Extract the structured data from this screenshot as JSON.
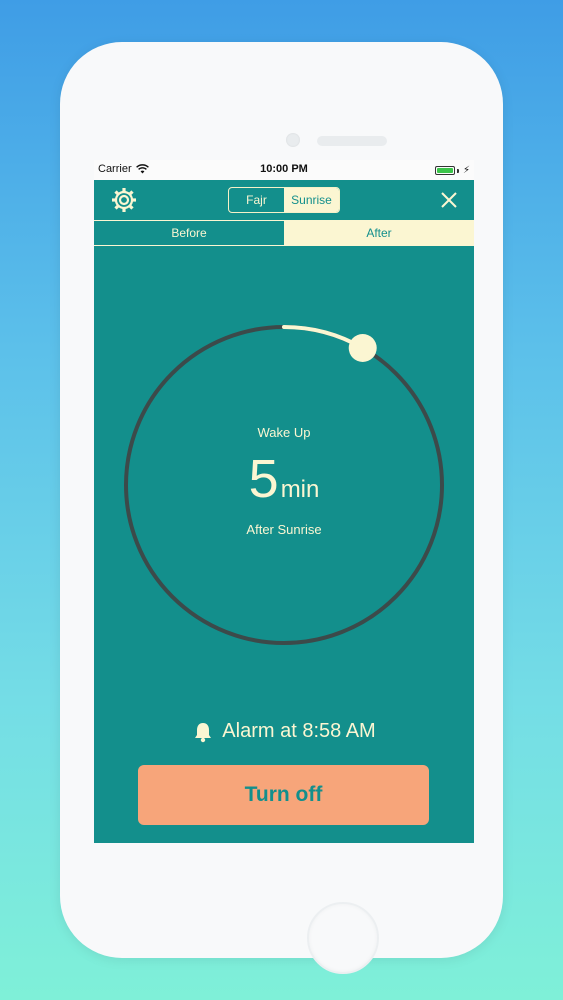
{
  "status_bar": {
    "carrier": "Carrier",
    "time": "10:00 PM",
    "battery_level_percent": 100,
    "wifi_icon": "wifi-icon",
    "charging_icon": "bolt-icon"
  },
  "nav": {
    "settings_icon": "gear-icon",
    "close_icon": "close-icon",
    "segments": [
      "Fajr",
      "Sunrise"
    ],
    "selected_segment": "Sunrise"
  },
  "tabs": {
    "items": [
      "Before",
      "After"
    ],
    "selected": "After"
  },
  "dial": {
    "label": "Wake Up",
    "value": "5",
    "unit": "min",
    "subtitle": "After Sunrise",
    "progress_fraction": 0.083
  },
  "alarm": {
    "icon": "bell-icon",
    "text": "Alarm at 8:58 AM"
  },
  "action": {
    "button_label": "Turn off"
  },
  "colors": {
    "screen_background": "#138f8c",
    "accent_cream": "#fbf6d2",
    "button_orange": "#f7a57a",
    "track_dark": "#3c4a4a"
  }
}
